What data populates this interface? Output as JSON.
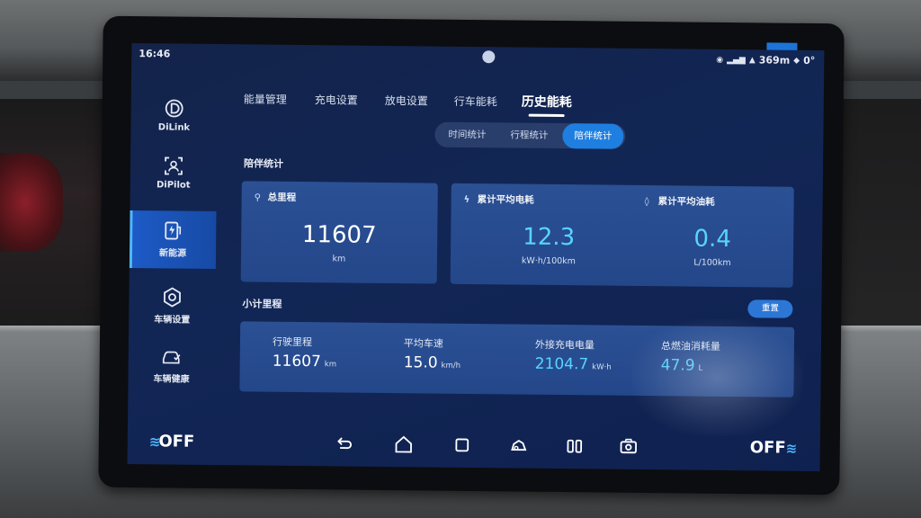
{
  "status": {
    "time": "16:46",
    "range": "369m",
    "temp": "0°"
  },
  "sidebar": {
    "items": [
      {
        "label": "DiLink",
        "icon": "dilink-icon"
      },
      {
        "label": "DiPilot",
        "icon": "dipilot-icon"
      },
      {
        "label": "新能源",
        "icon": "energy-icon"
      },
      {
        "label": "车辆设置",
        "icon": "settings-icon"
      },
      {
        "label": "车辆健康",
        "icon": "vehicle-health-icon"
      }
    ],
    "active_index": 2
  },
  "tabs": [
    {
      "label": "能量管理"
    },
    {
      "label": "充电设置"
    },
    {
      "label": "放电设置"
    },
    {
      "label": "行车能耗"
    },
    {
      "label": "历史能耗"
    }
  ],
  "active_tab": 4,
  "segments": [
    {
      "label": "时间统计"
    },
    {
      "label": "行程统计"
    },
    {
      "label": "陪伴统计"
    }
  ],
  "active_segment": 2,
  "section_companion": "陪伴统计",
  "cards": [
    {
      "title": "总里程",
      "value": "11607",
      "unit": "km"
    },
    {
      "title": "累计平均电耗",
      "value": "12.3",
      "unit": "kW·h/100km"
    },
    {
      "title": "累计平均油耗",
      "value": "0.4",
      "unit": "L/100km"
    }
  ],
  "section_trip": "小计里程",
  "reset_label": "重置",
  "trip": [
    {
      "label": "行驶里程",
      "value": "11607",
      "unit": "km"
    },
    {
      "label": "平均车速",
      "value": "15.0",
      "unit": "km/h"
    },
    {
      "label": "外接充电电量",
      "value": "2104.7",
      "unit": "kW·h"
    },
    {
      "label": "总燃油消耗量",
      "value": "47.9",
      "unit": "L"
    }
  ],
  "navbar": {
    "left_off": "OFF",
    "right_off": "OFF"
  },
  "colors": {
    "accent": "#1e7fe0",
    "cyan_value": "#58d4ff",
    "card_bg": "#2b5094",
    "screen_bg": "#13234a"
  }
}
